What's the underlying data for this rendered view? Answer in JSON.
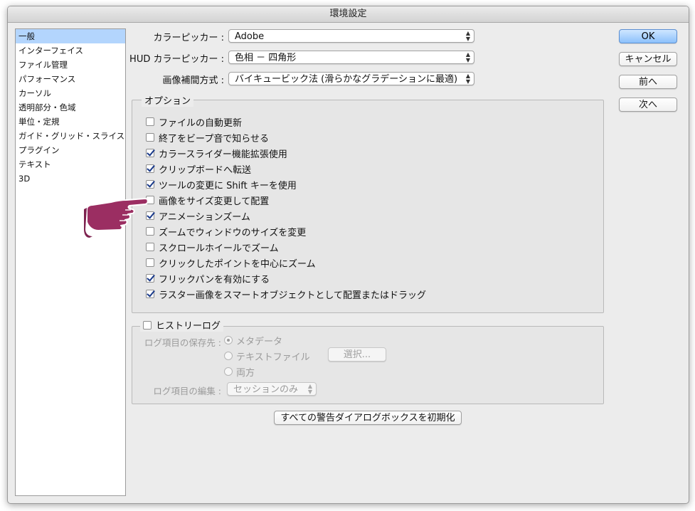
{
  "window": {
    "title": "環境設定"
  },
  "sidebar": {
    "items": [
      {
        "label": "一般",
        "selected": true
      },
      {
        "label": "インターフェイス"
      },
      {
        "label": "ファイル管理"
      },
      {
        "label": "パフォーマンス"
      },
      {
        "label": "カーソル"
      },
      {
        "label": "透明部分・色域"
      },
      {
        "label": "単位・定規"
      },
      {
        "label": "ガイド・グリッド・スライス"
      },
      {
        "label": "プラグイン"
      },
      {
        "label": "テキスト"
      },
      {
        "label": "3D"
      }
    ]
  },
  "general": {
    "color_picker": {
      "label": "カラーピッカー :",
      "value": "Adobe"
    },
    "hud_color_picker": {
      "label": "HUD カラーピッカー :",
      "value": "色相 － 四角形"
    },
    "interpolation": {
      "label": "画像補間方式 :",
      "value": "バイキュービック法 (滑らかなグラデーションに最適)"
    }
  },
  "options": {
    "legend": "オプション",
    "items": [
      {
        "label": "ファイルの自動更新",
        "checked": false
      },
      {
        "label": "終了をビープ音で知らせる",
        "checked": false
      },
      {
        "label": "カラースライダー機能拡張使用",
        "checked": true
      },
      {
        "label": "クリップボードへ転送",
        "checked": true
      },
      {
        "label": "ツールの変更に Shift キーを使用",
        "checked": true
      },
      {
        "label": "画像をサイズ変更して配置",
        "checked": false
      },
      {
        "label": "アニメーションズーム",
        "checked": true
      },
      {
        "label": "ズームでウィンドウのサイズを変更",
        "checked": false
      },
      {
        "label": "スクロールホイールでズーム",
        "checked": false
      },
      {
        "label": "クリックしたポイントを中心にズーム",
        "checked": false
      },
      {
        "label": "フリックパンを有効にする",
        "checked": true
      },
      {
        "label": "ラスター画像をスマートオブジェクトとして配置またはドラッグ",
        "checked": true
      }
    ]
  },
  "history": {
    "legend": "ヒストリーログ",
    "checked": false,
    "save_label": "ログ項目の保存先 :",
    "radios": [
      {
        "label": "メタデータ",
        "selected": true
      },
      {
        "label": "テキストファイル",
        "selected": false
      },
      {
        "label": "両方",
        "selected": false
      }
    ],
    "choose_button": "選択...",
    "edit_label": "ログ項目の編集 :",
    "edit_value": "セッションのみ"
  },
  "reset_button": "すべての警告ダイアログボックスを初期化",
  "buttons": {
    "ok": "OK",
    "cancel": "キャンセル",
    "prev": "前へ",
    "next": "次へ"
  },
  "colors": {
    "accent": "#b3d5fd",
    "default_button": "#8cc1fb",
    "pointer_hand": "#9b2e62"
  },
  "icons": {
    "pointer": "pointing-hand-icon"
  }
}
